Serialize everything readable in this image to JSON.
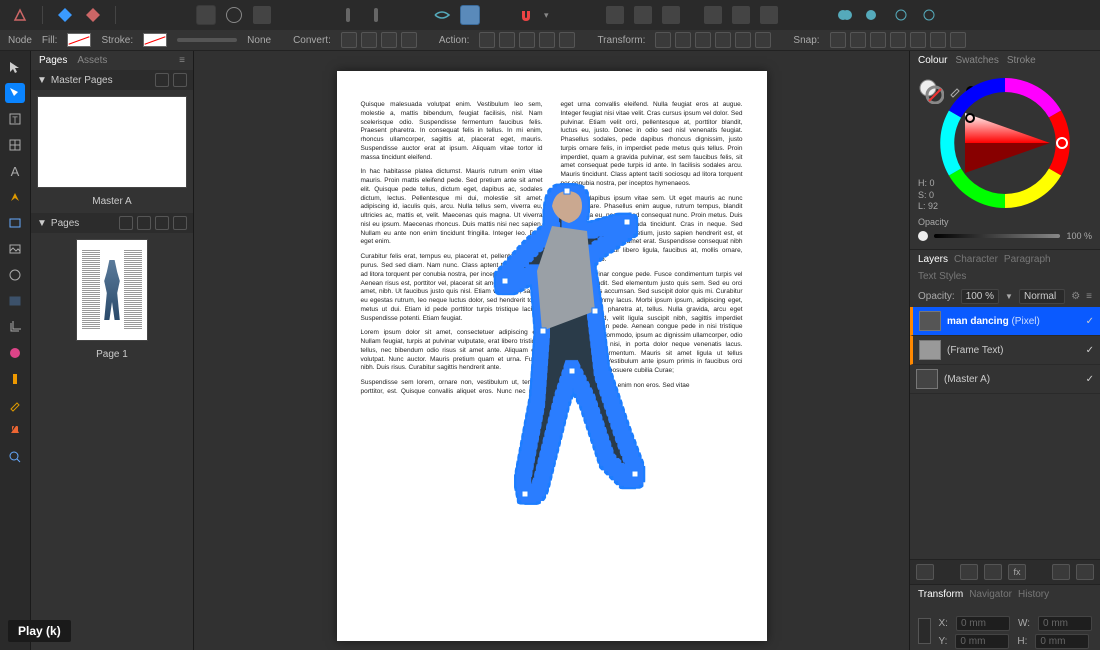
{
  "context": {
    "tool_label": "Node",
    "fill_label": "Fill:",
    "stroke_label": "Stroke:",
    "none_label": "None",
    "convert_label": "Convert:",
    "action_label": "Action:",
    "transform_label": "Transform:",
    "snap_label": "Snap:"
  },
  "pages_panel": {
    "tab_pages": "Pages",
    "tab_assets": "Assets",
    "section_master": "Master Pages",
    "master_a": "Master A",
    "section_pages": "Pages",
    "page_1": "Page 1"
  },
  "colour_panel": {
    "tab_colour": "Colour",
    "tab_swatches": "Swatches",
    "tab_stroke": "Stroke",
    "h": "H: 0",
    "s": "S: 0",
    "l": "L: 92",
    "opacity_label": "Opacity",
    "opacity_value": "100 %"
  },
  "layers_panel": {
    "tab_layers": "Layers",
    "tab_character": "Character",
    "tab_paragraph": "Paragraph",
    "tab_text_styles": "Text Styles",
    "opacity_label": "Opacity:",
    "opacity_value": "100 %",
    "blend_mode": "Normal",
    "layers": [
      {
        "name": "man dancing",
        "type": "(Pixel)"
      },
      {
        "name": "(Frame Text)",
        "type": ""
      },
      {
        "name": "(Master A)",
        "type": ""
      }
    ]
  },
  "transform_panel": {
    "tab_transform": "Transform",
    "tab_navigator": "Navigator",
    "tab_history": "History",
    "x_label": "X:",
    "y_label": "Y:",
    "w_label": "W:",
    "h_label": "H:",
    "x_val": "0 mm",
    "y_val": "0 mm",
    "w_val": "0 mm",
    "h_val": "0 mm"
  },
  "play_label": "Play (k)",
  "lorem": {
    "p1": "Quisque malesuada volutpat enim. Vestibulum leo sem, molestie a, mattis bibendum, feugiat facilisis, nisl. Nam scelerisque odio. Suspendisse fermentum faucibus felis. Praesent pharetra. In consequat felis in tellus. In mi enim, rhoncus ullamcorper, sagittis at, placerat eget, mauris. Suspendisse auctor erat at ipsum. Aliquam vitae tortor id massa tincidunt eleifend.",
    "p2": "In hac habitasse platea dictumst. Mauris rutrum enim vitae mauris. Proin mattis eleifend pede. Sed pretium ante sit amet elit. Quisque pede tellus, dictum eget, dapibus ac, sodales dictum, lectus. Pellentesque mi dui, molestie sit amet, adipiscing id, iaculis quis, arcu. Nulla tellus sem, viverra eu, ultricies ac, mattis et, velit. Maecenas quis magna. Ut viverra nisl eu ipsum. Maecenas rhoncus. Duis mattis nisi nec sapien. Nullam eu ante non enim tincidunt fringilla. Integer leo. Duis eget enim.",
    "p3": "Curabitur felis erat, tempus eu, placerat et, pellentesque sed, purus. Sed sed diam. Nam nunc. Class aptent taciti sociosqu ad litora torquent per conubia nostra, per inceptos hymenaeos. Aenean risus est, porttitor vel, placerat sit amet, vestibulum sit amet, nibh. Ut faucibus justo quis nisl. Etiam vulputate, sapien eu egestas rutrum, leo neque luctus dolor, sed hendrerit tortor metus ut dui. Etiam id pede porttitor turpis tristique lacinia. Suspendisse potenti. Etiam feugiat.",
    "p4": "Lorem ipsum dolor sit amet, consectetuer adipiscing elit. Nullam feugiat, turpis at pulvinar vulputate, erat libero tristique tellus, nec bibendum odio risus sit amet ante. Aliquam erat volutpat. Nunc auctor. Mauris pretium quam et urna. Fusce nibh. Duis risus. Curabitur sagittis hendrerit ante.",
    "p5": "Suspendisse sem lorem, ornare non, vestibulum ut, tempor porttitor, est. Quisque convallis aliquet eros. Nunc nec nulla eget urna convallis eleifend. Nulla feugiat eros at augue. Integer feugiat nisi vitae velit. Cras cursus ipsum vel dolor. Sed pulvinar. Etiam velit orci, pellentesque at, porttitor blandit, luctus eu, justo. Donec in odio sed nisl venenatis feugiat. Phasellus sodales, pede dapibus rhoncus dignissim, justo turpis ornare felis, in imperdiet pede metus quis tellus. Proin imperdiet, quam a gravida pulvinar, est sem faucibus felis, sit amet consequat pede turpis id ante. In facilisis sodales arcu. Mauris tincidunt. Class aptent taciti sociosqu ad litora torquent per conubia nostra, per inceptos hymenaeos.",
    "p6": "Aliquam dapibus ipsum vitae sem. Ut eget mauris ac nunc luctus ornare. Phasellus enim augue, rutrum tempus, blandit in, vehicula eu, neque. Sed consequat nunc. Proin metus. Duis at mi non tellus malesuada tincidunt. Cras in neque. Sed lacinia, felis ut sodales pretium, justo sapien hendrerit est, et convallis nisi quam sit amet erat. Suspendisse consequat nibh a mauris. Curabitur libero ligula, faucibus at, mollis ornare, mattis et, libero.",
    "p7": "Aliquam pulvinar congue pede. Fusce condimentum turpis vel dolor. Ut blandit. Sed elementum justo quis sem. Sed eu orci eu ante iaculis accumsan. Sed suscipit dolor quis mi. Curabitur ultricies nonummy lacus. Morbi ipsum ipsum, adipiscing eget, tincidunt vitae, pharetra at, tellus. Nulla gravida, arcu eget dictum eleifend, velit ligula suscipit nibh, sagittis imperdiet metus nunc non pede. Aenean congue pede in nisi tristique interdum. Sed commodo, ipsum ac dignissim ullamcorper, odio nulla venenatis nisi, in porta dolor neque venenatis lacus. Pellentesque fermentum. Mauris sit amet ligula ut tellus gravida mattis. Vestibulum ante ipsum primis in faucibus orci luctus et ultrices posuere cubilia Curae;",
    "p8": "Vestibulum semper enim non eros. Sed vitae"
  }
}
